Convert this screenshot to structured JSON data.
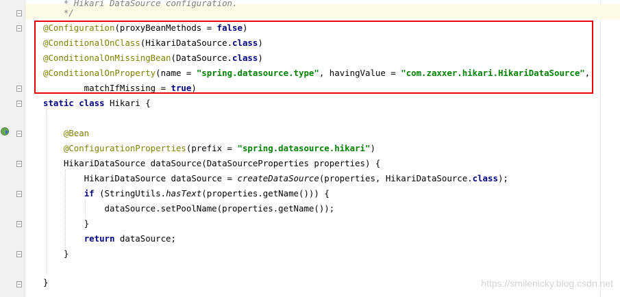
{
  "editor": {
    "lines": [
      {
        "id": "comment-title",
        "segments": [
          {
            "t": "    * Hikari DataSource configuration.",
            "c": "cmt"
          }
        ]
      },
      {
        "id": "comment-end",
        "segments": [
          {
            "t": "    */",
            "c": "cmt"
          }
        ]
      },
      {
        "id": "annotation-configuration",
        "segments": [
          {
            "t": "@Configuration",
            "c": "ann"
          },
          {
            "t": "(proxyBeanMethods = ",
            "c": ""
          },
          {
            "t": "false",
            "c": "kw"
          },
          {
            "t": ")",
            "c": ""
          }
        ]
      },
      {
        "id": "annotation-conditional-on-class",
        "segments": [
          {
            "t": "@ConditionalOnClass",
            "c": "ann"
          },
          {
            "t": "(HikariDataSource.",
            "c": ""
          },
          {
            "t": "class",
            "c": "kw"
          },
          {
            "t": ")",
            "c": ""
          }
        ]
      },
      {
        "id": "annotation-conditional-on-missing-bean",
        "segments": [
          {
            "t": "@ConditionalOnMissingBean",
            "c": "ann"
          },
          {
            "t": "(DataSource.",
            "c": ""
          },
          {
            "t": "class",
            "c": "kw"
          },
          {
            "t": ")",
            "c": ""
          }
        ]
      },
      {
        "id": "annotation-conditional-on-property",
        "segments": [
          {
            "t": "@ConditionalOnProperty",
            "c": "ann"
          },
          {
            "t": "(name = ",
            "c": ""
          },
          {
            "t": "\"spring.datasource.type\"",
            "c": "str"
          },
          {
            "t": ", havingValue = ",
            "c": ""
          },
          {
            "t": "\"com.zaxxer.hikari.HikariDataSource\"",
            "c": "str"
          },
          {
            "t": ",",
            "c": ""
          }
        ]
      },
      {
        "id": "match-if-missing",
        "segments": [
          {
            "t": "        matchIfMissing = ",
            "c": ""
          },
          {
            "t": "true",
            "c": "kw"
          },
          {
            "t": ")",
            "c": ""
          }
        ]
      },
      {
        "id": "class-declaration",
        "segments": [
          {
            "t": "static class ",
            "c": "kw"
          },
          {
            "t": "Hikari {",
            "c": ""
          }
        ]
      },
      {
        "id": "blank-1",
        "segments": []
      },
      {
        "id": "annotation-bean",
        "segments": [
          {
            "t": "    @Bean",
            "c": "ann"
          }
        ]
      },
      {
        "id": "annotation-configuration-properties",
        "segments": [
          {
            "t": "    @ConfigurationProperties",
            "c": "ann"
          },
          {
            "t": "(prefix = ",
            "c": ""
          },
          {
            "t": "\"spring.datasource.hikari\"",
            "c": "str"
          },
          {
            "t": ")",
            "c": ""
          }
        ]
      },
      {
        "id": "method-signature",
        "segments": [
          {
            "t": "    HikariDataSource dataSource(DataSourceProperties properties) {",
            "c": ""
          }
        ]
      },
      {
        "id": "create-datasource",
        "segments": [
          {
            "t": "        HikariDataSource dataSource = ",
            "c": ""
          },
          {
            "t": "createDataSource",
            "c": "it"
          },
          {
            "t": "(properties, HikariDataSource.",
            "c": ""
          },
          {
            "t": "class",
            "c": "kw"
          },
          {
            "t": ");",
            "c": ""
          }
        ]
      },
      {
        "id": "if-has-text",
        "segments": [
          {
            "t": "        ",
            "c": ""
          },
          {
            "t": "if ",
            "c": "kw"
          },
          {
            "t": "(StringUtils.",
            "c": ""
          },
          {
            "t": "hasText",
            "c": "it"
          },
          {
            "t": "(properties.getName())) {",
            "c": ""
          }
        ]
      },
      {
        "id": "set-pool-name",
        "segments": [
          {
            "t": "            dataSource.setPoolName(properties.getName());",
            "c": ""
          }
        ]
      },
      {
        "id": "if-close",
        "segments": [
          {
            "t": "        }",
            "c": ""
          }
        ]
      },
      {
        "id": "return-statement",
        "segments": [
          {
            "t": "        ",
            "c": ""
          },
          {
            "t": "return ",
            "c": "kw"
          },
          {
            "t": "dataSource;",
            "c": ""
          }
        ]
      },
      {
        "id": "method-close",
        "segments": [
          {
            "t": "    }",
            "c": ""
          }
        ]
      },
      {
        "id": "blank-2",
        "segments": []
      },
      {
        "id": "class-close",
        "segments": [
          {
            "t": "}",
            "c": ""
          }
        ]
      }
    ]
  },
  "watermark": "https://smilenicky.blog.csdn.net",
  "colors": {
    "annotation": "#808000",
    "keyword": "#000080",
    "string": "#008000",
    "comment": "#808080",
    "highlight_box": "#e60000"
  }
}
